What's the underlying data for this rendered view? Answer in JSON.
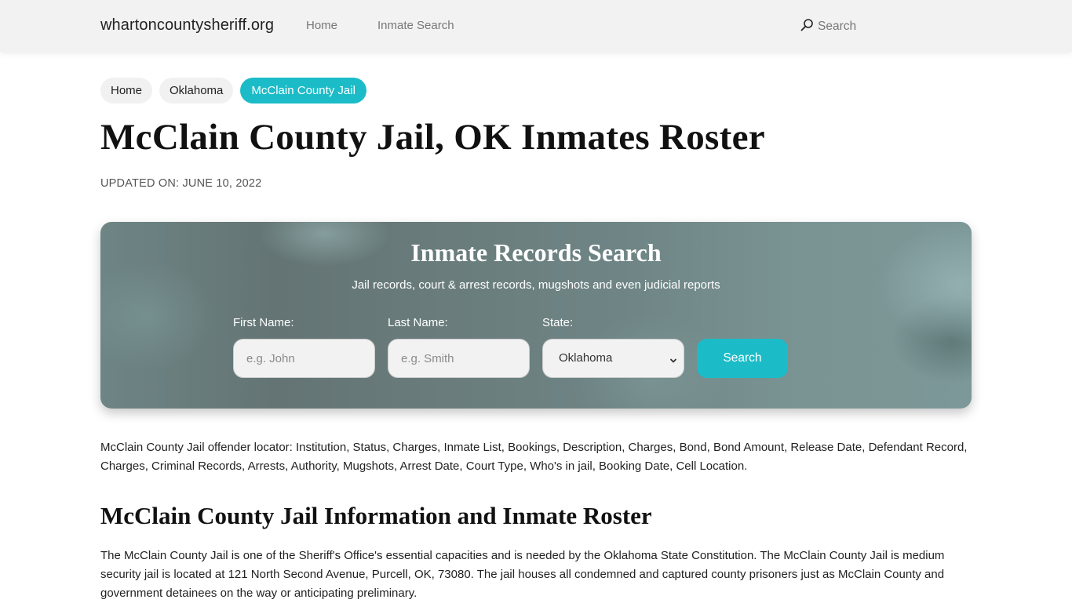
{
  "header": {
    "brand": "whartoncountysheriff.org",
    "nav": [
      {
        "label": "Home"
      },
      {
        "label": "Inmate Search"
      }
    ],
    "search_label": "Search",
    "search_icon": "search-icon"
  },
  "breadcrumb": [
    {
      "label": "Home",
      "active": false
    },
    {
      "label": "Oklahoma",
      "active": false
    },
    {
      "label": "McClain County Jail",
      "active": true
    }
  ],
  "page": {
    "title": "McClain County Jail, OK Inmates Roster",
    "updated": "UPDATED ON: JUNE 10, 2022"
  },
  "search_panel": {
    "title": "Inmate Records Search",
    "subtitle": "Jail records, court & arrest records, mugshots and even judicial reports",
    "first_name": {
      "label": "First Name:",
      "placeholder": "e.g. John",
      "value": ""
    },
    "last_name": {
      "label": "Last Name:",
      "placeholder": "e.g. Smith",
      "value": ""
    },
    "state": {
      "label": "State:",
      "selected": "Oklahoma"
    },
    "button_label": "Search"
  },
  "content": {
    "description": "McClain County Jail offender locator: Institution, Status, Charges, Inmate List, Bookings, Description, Charges, Bond, Bond Amount, Release Date, Defendant Record, Charges, Criminal Records, Arrests, Authority, Mugshots, Arrest Date, Court Type, Who's in jail, Booking Date, Cell Location.",
    "section_title": "McClain County Jail Information and Inmate Roster",
    "section_body": "The McClain County Jail is one of the Sheriff's Office's essential capacities and is needed by the Oklahoma State Constitution. The McClain County Jail is medium security jail is located at 121 North Second Avenue, Purcell, OK, 73080. The jail houses all condemned and captured county prisoners just as McClain County and government detainees on the way or anticipating preliminary."
  },
  "colors": {
    "accent": "#1bbcc8",
    "header_bg": "#f2f2f2",
    "crumb_bg": "#f1f1f1"
  }
}
